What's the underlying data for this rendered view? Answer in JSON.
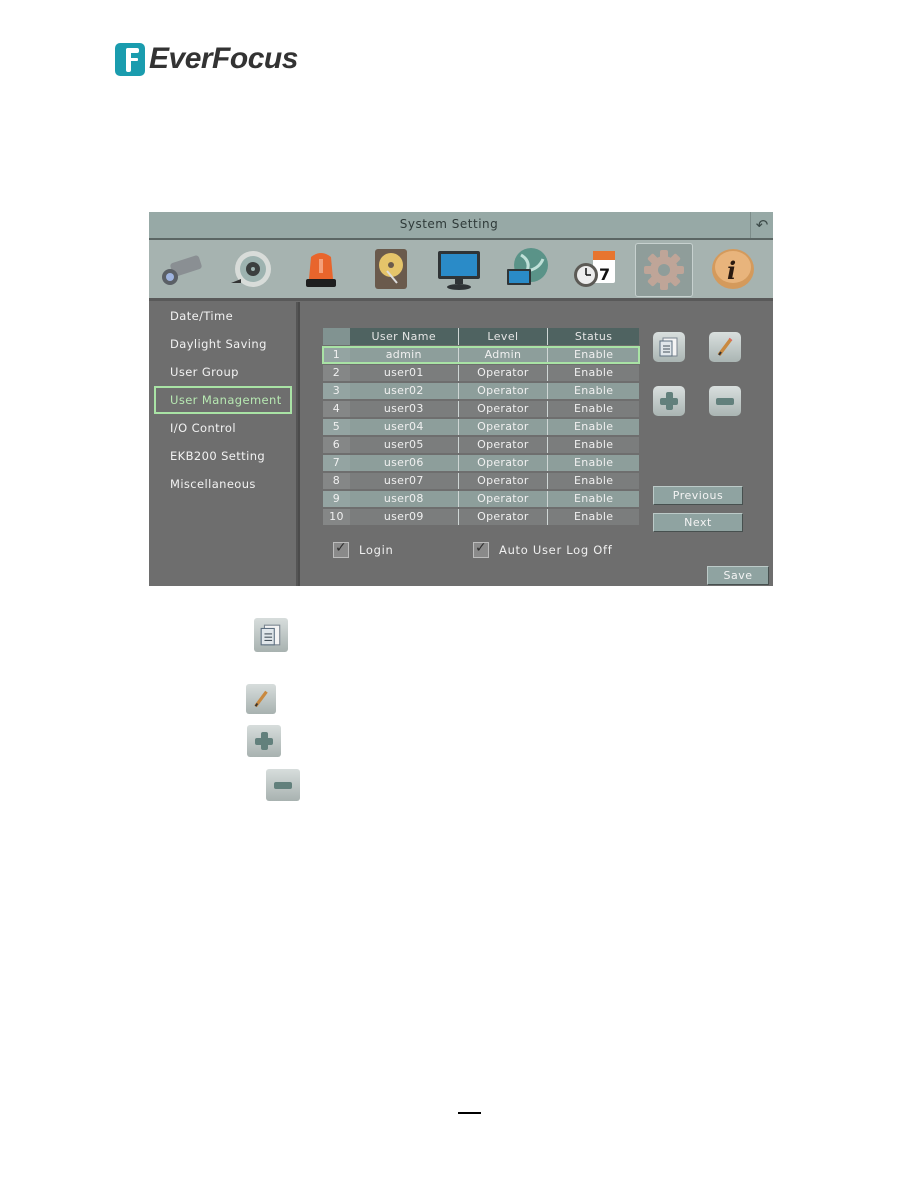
{
  "brand": {
    "name": "EverFocus",
    "color": "#1a9cae"
  },
  "window": {
    "title": "System Setting",
    "back_icon": "back-arrow-icon",
    "toolbar_icons": [
      {
        "name": "camera-icon"
      },
      {
        "name": "record-reel-icon"
      },
      {
        "name": "alarm-light-icon"
      },
      {
        "name": "hard-disk-icon"
      },
      {
        "name": "monitor-icon"
      },
      {
        "name": "network-globe-icon"
      },
      {
        "name": "schedule-clock-calendar-icon",
        "calendar_day": "7"
      },
      {
        "name": "system-gear-icon",
        "active": true
      },
      {
        "name": "info-icon"
      }
    ]
  },
  "menu": {
    "items": [
      {
        "label": "Date/Time"
      },
      {
        "label": "Daylight Saving"
      },
      {
        "label": "User Group"
      },
      {
        "label": "User Management",
        "selected": true
      },
      {
        "label": "I/O Control"
      },
      {
        "label": "EKB200 Setting"
      },
      {
        "label": "Miscellaneous"
      }
    ]
  },
  "table": {
    "headers": [
      "",
      "User Name",
      "Level",
      "Status"
    ],
    "rows": [
      {
        "no": "1",
        "user": "admin",
        "level": "Admin",
        "status": "Enable",
        "selected": true
      },
      {
        "no": "2",
        "user": "user01",
        "level": "Operator",
        "status": "Enable"
      },
      {
        "no": "3",
        "user": "user02",
        "level": "Operator",
        "status": "Enable"
      },
      {
        "no": "4",
        "user": "user03",
        "level": "Operator",
        "status": "Enable"
      },
      {
        "no": "5",
        "user": "user04",
        "level": "Operator",
        "status": "Enable"
      },
      {
        "no": "6",
        "user": "user05",
        "level": "Operator",
        "status": "Enable"
      },
      {
        "no": "7",
        "user": "user06",
        "level": "Operator",
        "status": "Enable"
      },
      {
        "no": "8",
        "user": "user07",
        "level": "Operator",
        "status": "Enable"
      },
      {
        "no": "9",
        "user": "user08",
        "level": "Operator",
        "status": "Enable"
      },
      {
        "no": "10",
        "user": "user09",
        "level": "Operator",
        "status": "Enable"
      }
    ]
  },
  "actions": {
    "detail_icon": "user-detail-icon",
    "edit_icon": "pencil-edit-icon",
    "add_icon": "plus-add-icon",
    "delete_icon": "minus-delete-icon",
    "previous": "Previous",
    "next": "Next",
    "save": "Save"
  },
  "options": {
    "login": {
      "label": "Login",
      "checked": true
    },
    "auto_logoff": {
      "label": "Auto User Log Off",
      "checked": true
    }
  },
  "colors": {
    "selection": "#a9e3a5",
    "panel": "#6e6e6e",
    "titlebar": "#97a9a6"
  }
}
